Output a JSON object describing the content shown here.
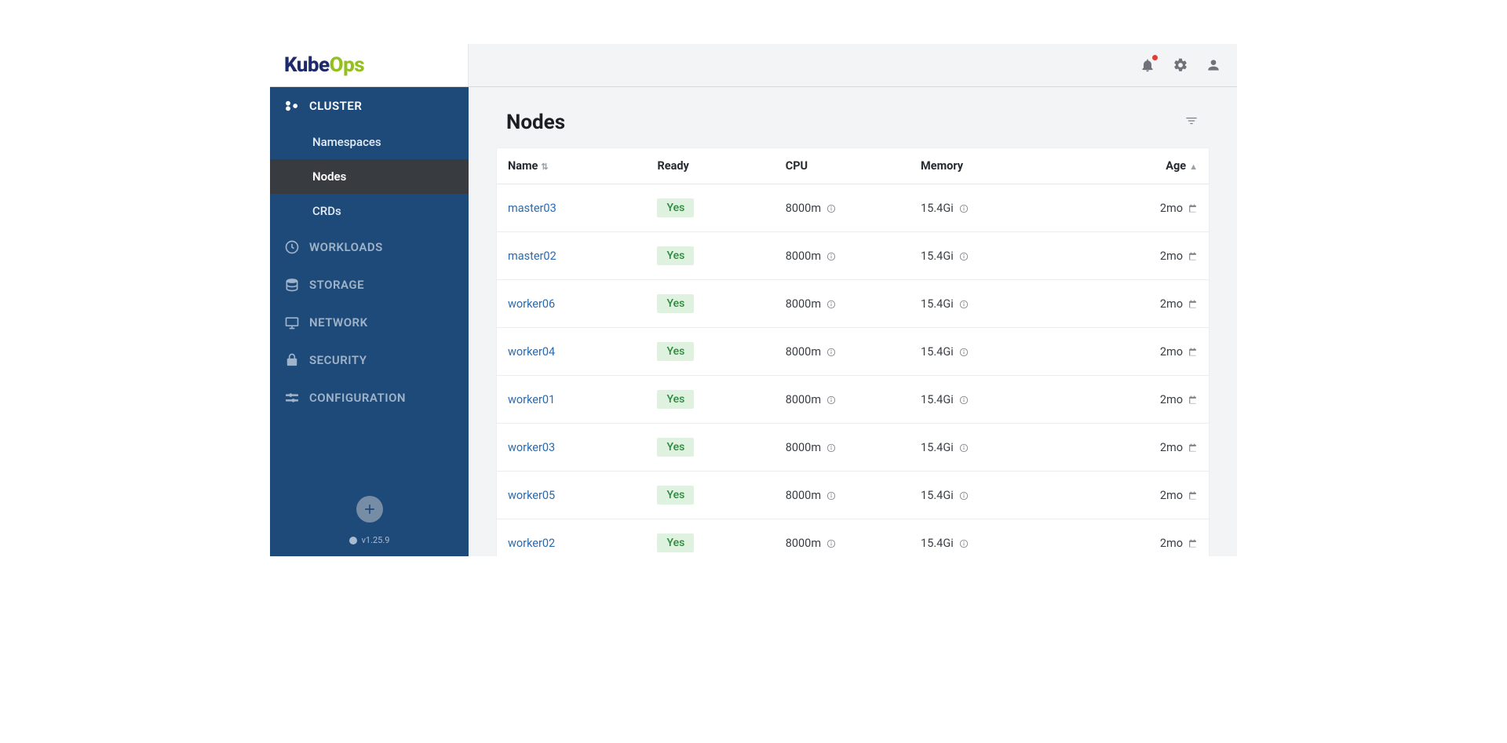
{
  "logo": {
    "part1": "Kube",
    "part2": "Ops"
  },
  "sidebar": {
    "version_prefix": "v",
    "version": "1.25.9",
    "sections": [
      {
        "id": "cluster",
        "label": "CLUSTER",
        "icon": "cluster-icon",
        "active": true,
        "children": [
          {
            "id": "namespaces",
            "label": "Namespaces",
            "selected": false
          },
          {
            "id": "nodes",
            "label": "Nodes",
            "selected": true
          },
          {
            "id": "crds",
            "label": "CRDs",
            "selected": false
          }
        ]
      },
      {
        "id": "workloads",
        "label": "WORKLOADS",
        "icon": "workloads-icon",
        "active": false
      },
      {
        "id": "storage",
        "label": "STORAGE",
        "icon": "storage-icon",
        "active": false
      },
      {
        "id": "network",
        "label": "NETWORK",
        "icon": "network-icon",
        "active": false
      },
      {
        "id": "security",
        "label": "SECURITY",
        "icon": "security-icon",
        "active": false
      },
      {
        "id": "configuration",
        "label": "CONFIGURATION",
        "icon": "configuration-icon",
        "active": false
      }
    ]
  },
  "page": {
    "title": "Nodes"
  },
  "table": {
    "columns": [
      {
        "key": "name",
        "label": "Name",
        "sortable": true
      },
      {
        "key": "ready",
        "label": "Ready"
      },
      {
        "key": "cpu",
        "label": "CPU"
      },
      {
        "key": "memory",
        "label": "Memory"
      },
      {
        "key": "age",
        "label": "Age",
        "sortable": true,
        "sorted": "asc"
      }
    ],
    "rows": [
      {
        "name": "master03",
        "ready": "Yes",
        "cpu": "8000m",
        "memory": "15.4Gi",
        "age": "2mo"
      },
      {
        "name": "master02",
        "ready": "Yes",
        "cpu": "8000m",
        "memory": "15.4Gi",
        "age": "2mo"
      },
      {
        "name": "worker06",
        "ready": "Yes",
        "cpu": "8000m",
        "memory": "15.4Gi",
        "age": "2mo"
      },
      {
        "name": "worker04",
        "ready": "Yes",
        "cpu": "8000m",
        "memory": "15.4Gi",
        "age": "2mo"
      },
      {
        "name": "worker01",
        "ready": "Yes",
        "cpu": "8000m",
        "memory": "15.4Gi",
        "age": "2mo"
      },
      {
        "name": "worker03",
        "ready": "Yes",
        "cpu": "8000m",
        "memory": "15.4Gi",
        "age": "2mo"
      },
      {
        "name": "worker05",
        "ready": "Yes",
        "cpu": "8000m",
        "memory": "15.4Gi",
        "age": "2mo"
      },
      {
        "name": "worker02",
        "ready": "Yes",
        "cpu": "8000m",
        "memory": "15.4Gi",
        "age": "2mo"
      }
    ]
  }
}
